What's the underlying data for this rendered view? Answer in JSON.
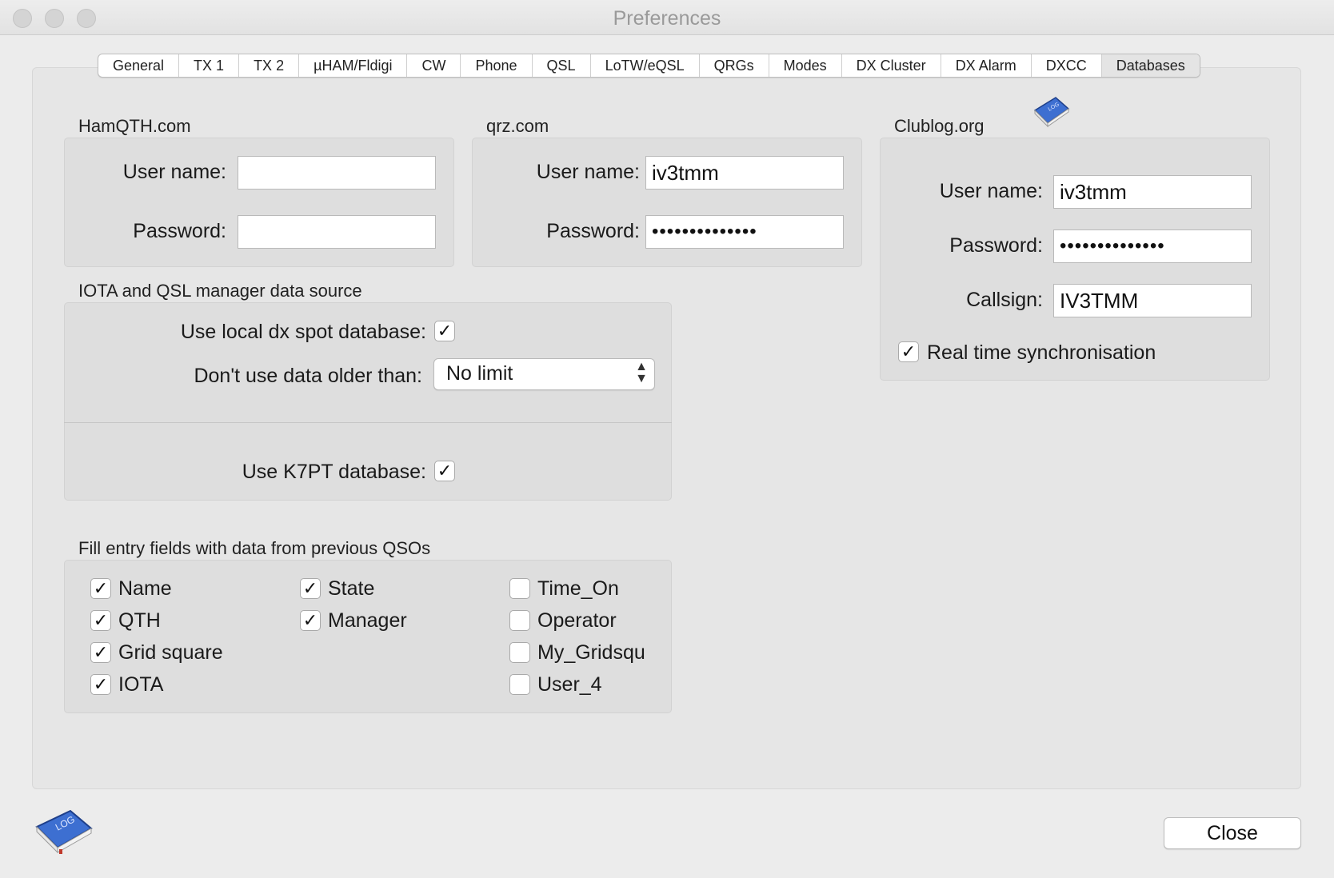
{
  "window": {
    "title": "Preferences"
  },
  "tabs": [
    {
      "label": "General"
    },
    {
      "label": "TX 1"
    },
    {
      "label": "TX 2"
    },
    {
      "label": "µHAM/Fldigi"
    },
    {
      "label": "CW"
    },
    {
      "label": "Phone"
    },
    {
      "label": "QSL"
    },
    {
      "label": "LoTW/eQSL"
    },
    {
      "label": "QRGs"
    },
    {
      "label": "Modes"
    },
    {
      "label": "DX Cluster"
    },
    {
      "label": "DX Alarm"
    },
    {
      "label": "DXCC"
    },
    {
      "label": "Databases"
    }
  ],
  "selected_tab": "Databases",
  "hamqth": {
    "title": "HamQTH.com",
    "username_label": "User name:",
    "username": "",
    "password_label": "Password:",
    "password": ""
  },
  "qrz": {
    "title": "qrz.com",
    "username_label": "User name:",
    "username": "iv3tmm",
    "password_label": "Password:",
    "password": "••••••••••••••"
  },
  "clublog": {
    "title": "Clublog.org",
    "username_label": "User name:",
    "username": "iv3tmm",
    "password_label": "Password:",
    "password": "••••••••••••••",
    "callsign_label": "Callsign:",
    "callsign": "IV3TMM",
    "realtime_label": "Real time synchronisation",
    "realtime_checked": true
  },
  "iota": {
    "title": "IOTA and QSL manager data source",
    "local_db_label": "Use local dx spot database:",
    "local_db_checked": true,
    "older_than_label": "Don't use data older than:",
    "older_than_value": "No limit",
    "k7pt_label": "Use K7PT database:",
    "k7pt_checked": true
  },
  "fill": {
    "title": "Fill entry fields with data from previous QSOs",
    "col1": [
      {
        "label": "Name",
        "checked": true
      },
      {
        "label": "QTH",
        "checked": true
      },
      {
        "label": "Grid square",
        "checked": true
      },
      {
        "label": "IOTA",
        "checked": true
      }
    ],
    "col2": [
      {
        "label": "State",
        "checked": true
      },
      {
        "label": "Manager",
        "checked": true
      }
    ],
    "col3": [
      {
        "label": "Time_On",
        "checked": false
      },
      {
        "label": "Operator",
        "checked": false
      },
      {
        "label": "My_Gridsqu",
        "checked": false
      },
      {
        "label": "User_4",
        "checked": false
      }
    ]
  },
  "icons": {
    "app": "log-book-icon",
    "clublog": "log-book-icon"
  },
  "close_label": "Close",
  "check_glyph": "✓"
}
